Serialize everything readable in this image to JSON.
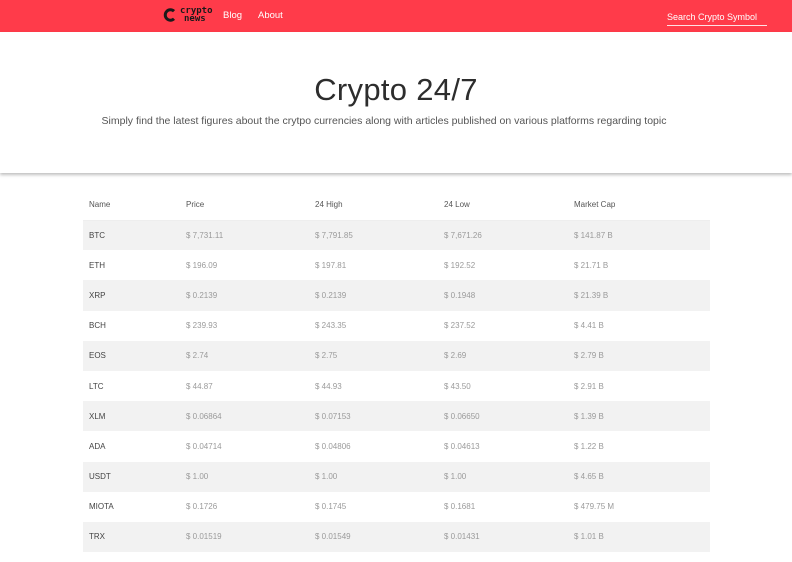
{
  "nav": {
    "logo_top": "crypto",
    "logo_bottom": "news",
    "blog": "Blog",
    "about": "About",
    "search_placeholder": "Search Crypto Symbol"
  },
  "hero": {
    "title": "Crypto 24/7",
    "subtitle": "Simply find the latest figures about the crytpo currencies along with articles published on various platforms regarding topic"
  },
  "table": {
    "headers": [
      "Name",
      "Price",
      "24 High",
      "24 Low",
      "Market Cap"
    ],
    "rows": [
      [
        "BTC",
        "$ 7,731.11",
        "$ 7,791.85",
        "$ 7,671.26",
        "$ 141.87 B"
      ],
      [
        "ETH",
        "$ 196.09",
        "$ 197.81",
        "$ 192.52",
        "$ 21.71 B"
      ],
      [
        "XRP",
        "$ 0.2139",
        "$ 0.2139",
        "$ 0.1948",
        "$ 21.39 B"
      ],
      [
        "BCH",
        "$ 239.93",
        "$ 243.35",
        "$ 237.52",
        "$ 4.41 B"
      ],
      [
        "EOS",
        "$ 2.74",
        "$ 2.75",
        "$ 2.69",
        "$ 2.79 B"
      ],
      [
        "LTC",
        "$ 44.87",
        "$ 44.93",
        "$ 43.50",
        "$ 2.91 B"
      ],
      [
        "XLM",
        "$ 0.06864",
        "$ 0.07153",
        "$ 0.06650",
        "$ 1.39 B"
      ],
      [
        "ADA",
        "$ 0.04714",
        "$ 0.04806",
        "$ 0.04613",
        "$ 1.22 B"
      ],
      [
        "USDT",
        "$ 1.00",
        "$ 1.00",
        "$ 1.00",
        "$ 4.65 B"
      ],
      [
        "MIOTA",
        "$ 0.1726",
        "$ 0.1745",
        "$ 0.1681",
        "$ 479.75 M"
      ],
      [
        "TRX",
        "$ 0.01519",
        "$ 0.01549",
        "$ 0.01431",
        "$ 1.01 B"
      ]
    ]
  },
  "colors": {
    "accent": "#ff3b4a",
    "row_stripe": "#f2f2f2"
  }
}
